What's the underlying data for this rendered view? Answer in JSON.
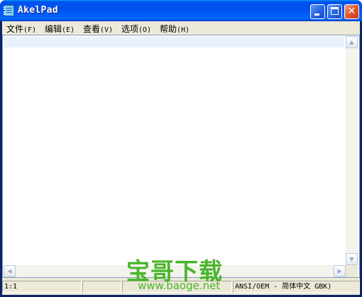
{
  "window": {
    "title": "AkelPad",
    "minimize_icon": "minimize-icon",
    "maximize_icon": "maximize-icon",
    "close_icon": "close-icon",
    "close_glyph": "✕"
  },
  "menu": {
    "items": [
      {
        "label": "文件",
        "mnemonic": "(F)"
      },
      {
        "label": "编辑",
        "mnemonic": "(E)"
      },
      {
        "label": "查看",
        "mnemonic": "(V)"
      },
      {
        "label": "选项",
        "mnemonic": "(O)"
      },
      {
        "label": "帮助",
        "mnemonic": "(H)"
      }
    ]
  },
  "editor": {
    "content": ""
  },
  "scrollbars": {
    "up_glyph": "▲",
    "down_glyph": "▼",
    "left_glyph": "◀",
    "right_glyph": "▶"
  },
  "statusbar": {
    "position": "1:1",
    "insert_mode": "",
    "modified": "",
    "encoding": "ANSI/OEM - 简体中文 GBK)"
  },
  "watermark": {
    "main": "宝哥下载",
    "url": "www.baoge.net"
  },
  "colors": {
    "titlebar": "#0055e5",
    "watermark": "#49b52b",
    "line_highlight": "#e8f2fe"
  }
}
